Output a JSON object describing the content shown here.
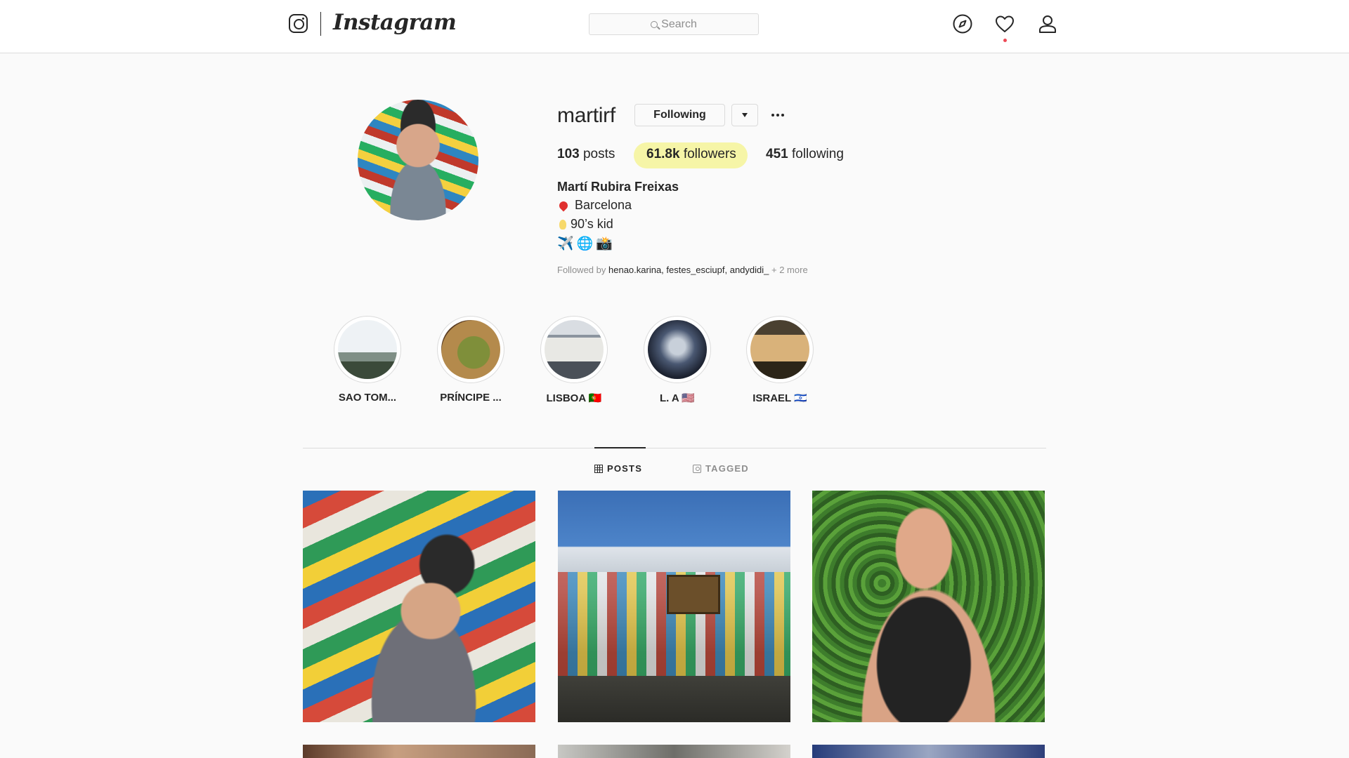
{
  "nav": {
    "brand": "Instagram",
    "search_placeholder": "Search",
    "icons": [
      "instagram-glyph-icon",
      "compass-icon",
      "heart-icon",
      "user-icon"
    ]
  },
  "profile": {
    "username": "martirf",
    "follow_button": "Following",
    "posts_count": "103",
    "posts_label": "posts",
    "followers_count": "61.8k",
    "followers_label": "followers",
    "following_count": "451",
    "following_label": "following",
    "full_name": "Martí Rubira Freixas",
    "bio_location": "Barcelona",
    "bio_tagline": "90’s kid",
    "bio_emojis": [
      "✈️",
      "🌐",
      "📸"
    ],
    "followed_by_prefix": "Followed by",
    "followed_by_users": "henao.karina, festes_esciupf, andydidi_",
    "followed_by_more": "+ 2 more"
  },
  "highlights": [
    {
      "label": "SAO TOM...",
      "colors": [
        "#eef2f5",
        "#2b3b2a"
      ]
    },
    {
      "label": "PRÍNCIPE ...",
      "colors": [
        "#b48a4c",
        "#6a8a2e"
      ]
    },
    {
      "label": "LISBOA 🇵🇹",
      "colors": [
        "#cfd5dc",
        "#4a5058"
      ]
    },
    {
      "label": "L. A 🇺🇸",
      "colors": [
        "#a9b4c2",
        "#1c2230"
      ]
    },
    {
      "label": "ISRAEL 🇮🇱",
      "colors": [
        "#b68a4e",
        "#2c2518"
      ]
    }
  ],
  "tabs": {
    "posts": "POSTS",
    "tagged": "TAGGED"
  },
  "colors": {
    "accent_highlight": "#f6f5a7",
    "notification_dot": "#ed4956",
    "border": "#dbdbdb"
  }
}
